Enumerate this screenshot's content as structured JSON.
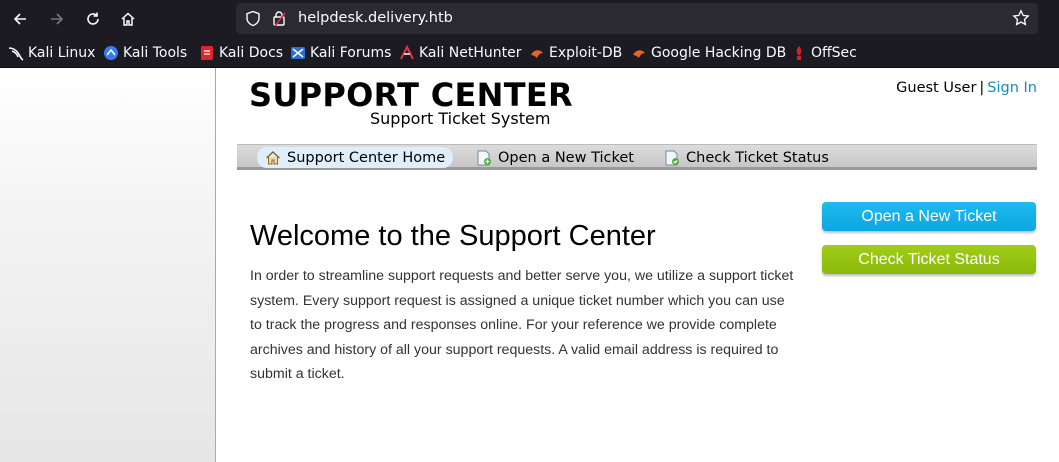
{
  "browser": {
    "url": "helpdesk.delivery.htb",
    "bookmarks": [
      {
        "label": "Kali Linux",
        "icon": "kali-dragon-icon"
      },
      {
        "label": "Kali Tools",
        "icon": "kali-tools-icon"
      },
      {
        "label": "Kali Docs",
        "icon": "kali-docs-icon"
      },
      {
        "label": "Kali Forums",
        "icon": "kali-forums-icon"
      },
      {
        "label": "Kali NetHunter",
        "icon": "nethunter-icon"
      },
      {
        "label": "Exploit-DB",
        "icon": "exploit-db-icon"
      },
      {
        "label": "Google Hacking DB",
        "icon": "ghdb-icon"
      },
      {
        "label": "OffSec",
        "icon": "offsec-icon"
      }
    ]
  },
  "header": {
    "title": "SUPPORT CENTER",
    "subtitle": "Support Ticket System",
    "user": "Guest User",
    "separator": "|",
    "sign_in": "Sign In"
  },
  "nav": {
    "items": [
      {
        "label": "Support Center Home",
        "icon": "home-icon"
      },
      {
        "label": "Open a New Ticket",
        "icon": "new-ticket-icon"
      },
      {
        "label": "Check Ticket Status",
        "icon": "ticket-status-icon"
      }
    ]
  },
  "main": {
    "heading": "Welcome to the Support Center",
    "body": "In order to streamline support requests and better serve you, we utilize a support ticket system. Every support request is assigned a unique ticket number which you can use to track the progress and responses online. For your reference we provide complete archives and history of all your support requests. A valid email address is required to submit a ticket."
  },
  "sidebar": {
    "open_ticket": "Open a New Ticket",
    "check_status": "Check Ticket Status"
  },
  "colors": {
    "link": "#128dbe",
    "open_button": "#0ca6e2",
    "status_button": "#8ab90a"
  }
}
